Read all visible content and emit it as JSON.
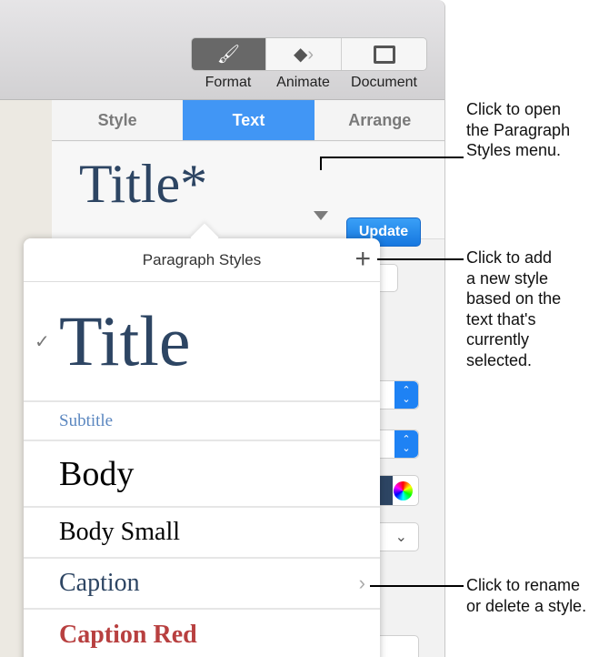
{
  "toolbar": {
    "buttons": [
      {
        "label": "Format",
        "icon": "paintbrush-icon"
      },
      {
        "label": "Animate",
        "icon": "animate-icon"
      },
      {
        "label": "Document",
        "icon": "document-icon"
      }
    ]
  },
  "tabs": [
    "Style",
    "Text",
    "Arrange"
  ],
  "current_style": "Title*",
  "update_label": "Update",
  "popover": {
    "title": "Paragraph Styles",
    "add": "+",
    "selected": "Title",
    "items": [
      "Title",
      "Subtitle",
      "Body",
      "Body Small",
      "Caption",
      "Caption Red"
    ]
  },
  "colors": {
    "accent": "#4196f5",
    "title": "#2d4563",
    "subtitle": "#5b87c0",
    "caption_red": "#b84040"
  },
  "callouts": {
    "styles_menu": [
      "Click to open",
      "the Paragraph",
      "Styles menu."
    ],
    "add": [
      "Click to add",
      "a new style",
      "based on the",
      "text that's",
      "currently",
      "selected."
    ],
    "rename": [
      "Click to rename",
      "or delete a style."
    ]
  }
}
